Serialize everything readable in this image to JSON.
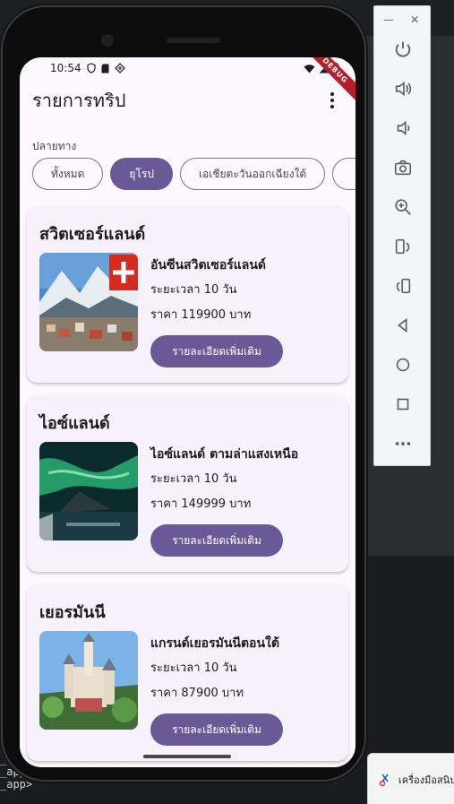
{
  "status_bar": {
    "time": "10:54",
    "debug_label": "DEBUG"
  },
  "app_bar": {
    "title": "รายการทริป"
  },
  "filter": {
    "label": "ปลายทาง",
    "chips": [
      {
        "label": "ทั้งหมด",
        "selected": false
      },
      {
        "label": "ยุโรป",
        "selected": true
      },
      {
        "label": "เอเชียตะวันออกเฉียงใต้",
        "selected": false
      },
      {
        "label": "",
        "selected": false
      }
    ]
  },
  "trips": [
    {
      "country": "สวิตเซอร์แลนด์",
      "name": "อันซีนสวิตเซอร์แลนด์",
      "duration": "ระยะเวลา 10 วัน",
      "price": "ราคา 119900 บาท",
      "button": "รายละเอียดเพิ่มเติม"
    },
    {
      "country": "ไอซ์แลนด์",
      "name": "ไอซ์แลนด์ ตามล่าแสงเหนือ",
      "duration": "ระยะเวลา 10 วัน",
      "price": "ราคา 149999 บาท",
      "button": "รายละเอียดเพิ่มเติม"
    },
    {
      "country": "เยอรมันนี",
      "name": "แกรนด์เยอรมันนีตอนใต้",
      "duration": "ระยะเวลา 10 วัน",
      "price": "ราคา 87900 บาท",
      "button": "รายละเอียดเพิ่มเติม"
    }
  ],
  "terminal": {
    "lines": [
      "_app>",
      "_app>",
      "_app>"
    ]
  },
  "notification": {
    "text": "เครื่องมือสนิป"
  },
  "colors": {
    "primary": "#6a5996",
    "surface": "#fdf7ff",
    "card": "#f7f1fb"
  }
}
